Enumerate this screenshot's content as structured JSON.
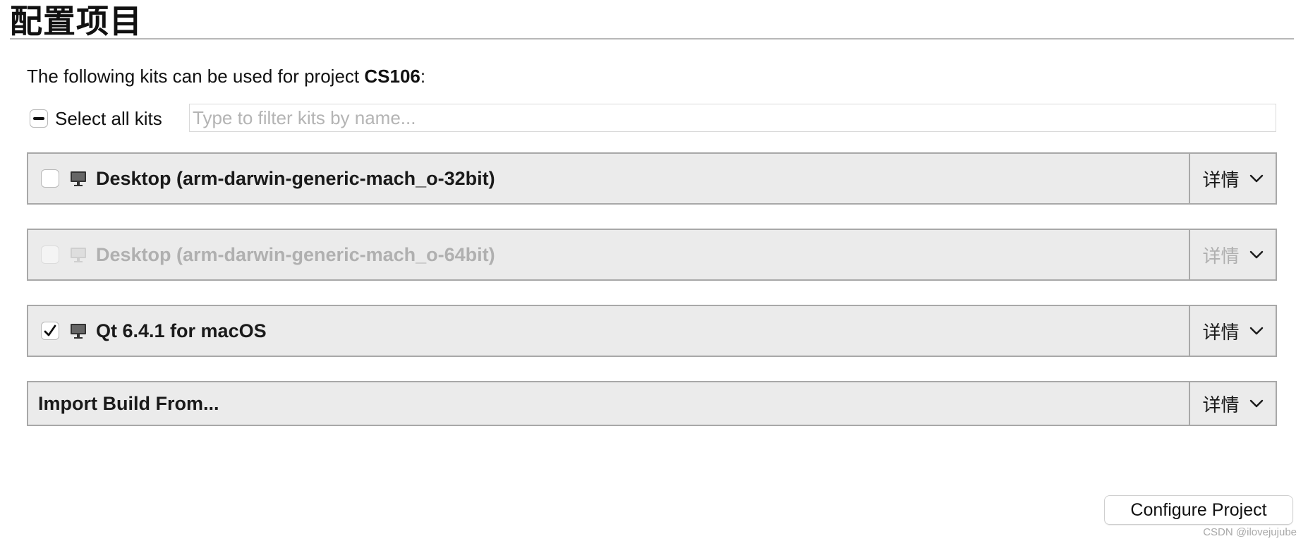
{
  "page": {
    "title": "配置项目",
    "intro_prefix": "The following kits can be used for project ",
    "project_name": "CS106",
    "intro_suffix": ":"
  },
  "select_all": {
    "label": "Select all kits",
    "state": "partial"
  },
  "filter": {
    "placeholder": "Type to filter kits by name...",
    "value": ""
  },
  "kits": [
    {
      "name": "Desktop (arm-darwin-generic-mach_o-32bit)",
      "checked": false,
      "enabled": true,
      "icon": "monitor-icon",
      "details_label": "详情"
    },
    {
      "name": "Desktop (arm-darwin-generic-mach_o-64bit)",
      "checked": false,
      "enabled": false,
      "icon": "monitor-icon",
      "details_label": "详情"
    },
    {
      "name": "Qt 6.4.1 for macOS",
      "checked": true,
      "enabled": true,
      "icon": "monitor-icon",
      "details_label": "详情"
    }
  ],
  "import_build": {
    "label": "Import Build From...",
    "details_label": "详情"
  },
  "configure_button": "Configure Project",
  "watermark": "CSDN @ilovejujube",
  "colors": {
    "row_background": "#ebebeb",
    "row_border": "#a8a8a8",
    "disabled_text": "#b0b0b0"
  }
}
